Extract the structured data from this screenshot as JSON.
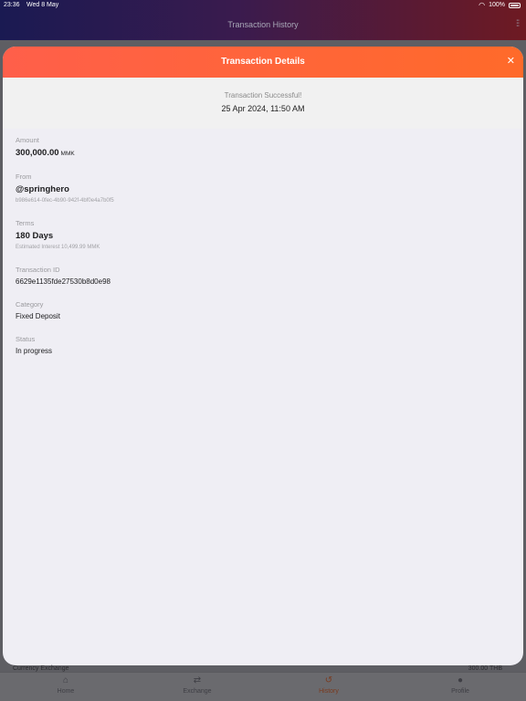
{
  "status_bar": {
    "time": "23:36",
    "date": "Wed 8 May",
    "battery": "100%"
  },
  "app": {
    "title": "Transaction History"
  },
  "modal": {
    "title": "Transaction Details",
    "summary_status": "Transaction Successful!",
    "summary_date": "25 Apr 2024, 11:50 AM",
    "fields": {
      "amount": {
        "label": "Amount",
        "value": "300,000.00",
        "unit": "MMK"
      },
      "from": {
        "label": "From",
        "value": "@springhero",
        "sub": "b986e614-0fec-4b90-942f-4bf0e4a7b0f5"
      },
      "terms": {
        "label": "Terms",
        "value": "180 Days",
        "sub": "Estimated Interest 10,499.99 MMK"
      },
      "transaction_id": {
        "label": "Transaction ID",
        "value": "6629e1135fde27530b8d0e98"
      },
      "category": {
        "label": "Category",
        "value": "Fixed Deposit"
      },
      "status": {
        "label": "Status",
        "value": "In progress"
      }
    }
  },
  "background_row": {
    "left": "Currency Exchange",
    "right": "300.00 THB"
  },
  "tabs": [
    {
      "label": "Home",
      "icon": "home-icon"
    },
    {
      "label": "Exchange",
      "icon": "exchange-icon"
    },
    {
      "label": "History",
      "icon": "history-icon",
      "active": true
    },
    {
      "label": "Profile",
      "icon": "profile-icon"
    }
  ],
  "colors": {
    "accent": "#ff6235",
    "header_gradient_start": "#1a1a52",
    "header_gradient_end": "#6e1a22"
  }
}
